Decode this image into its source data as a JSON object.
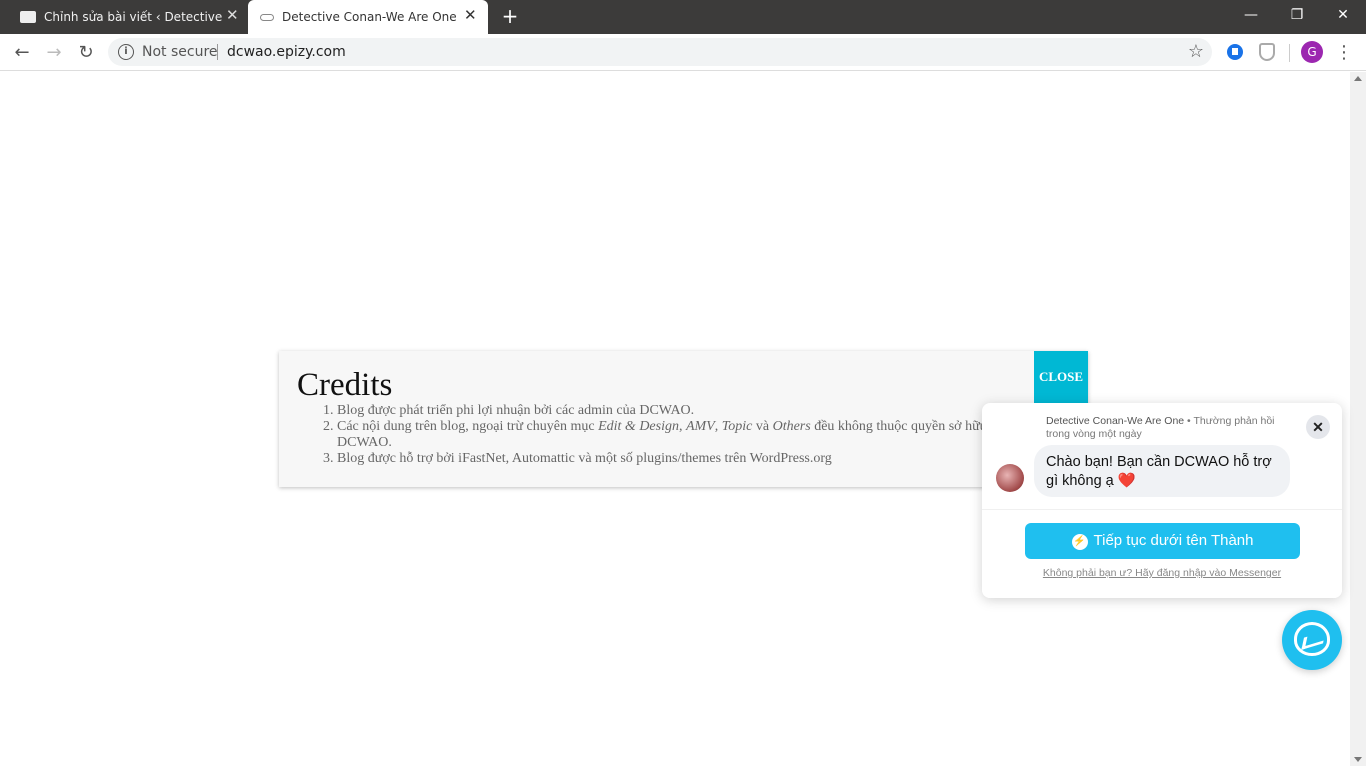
{
  "browser": {
    "tabs": [
      {
        "title": "Chỉnh sửa bài viết ‹ Detective Conan",
        "active": false
      },
      {
        "title": "Detective Conan-We Are One",
        "active": true
      }
    ],
    "new_tab": "+",
    "window_controls": {
      "minimize": "—",
      "restore": "❐",
      "close": "✕"
    },
    "omnibox": {
      "security": "Not secure",
      "url": "dcwao.epizy.com"
    },
    "profile_initial": "G"
  },
  "credits": {
    "title": "Credits",
    "close_label": "CLOSE",
    "items": [
      {
        "text": "Blog được phát triển phi lợi nhuận bởi các admin của DCWAO."
      },
      {
        "before": "Các nội dung trên blog, ngoại trừ chuyên mục ",
        "em1": "Edit & Design",
        "sep1": ", ",
        "em2": "AMV",
        "sep2": ", ",
        "em3": "Topic",
        "sep3": " và ",
        "em4": "Others",
        "after": " đều không thuộc quyền sở hữu của DCWAO."
      },
      {
        "text": "Blog được hỗ trợ bởi iFastNet, Automattic và một số plugins/themes trên WordPress.org"
      }
    ]
  },
  "messenger": {
    "page_name": "Detective Conan-We Are One",
    "response_time": " • Thường phản hồi trong vòng một ngày",
    "greeting": "Chào bạn! Bạn cần DCWAO hỗ trợ gì không ạ",
    "heart": "❤️",
    "cta": "Tiếp tục dưới tên Thành",
    "login_link": "Không phải bạn ư? Hãy đăng nhập vào Messenger"
  },
  "colors": {
    "accent": "#00b8d4",
    "messenger": "#1fbfef",
    "tabstrip": "#3c3b3a"
  }
}
